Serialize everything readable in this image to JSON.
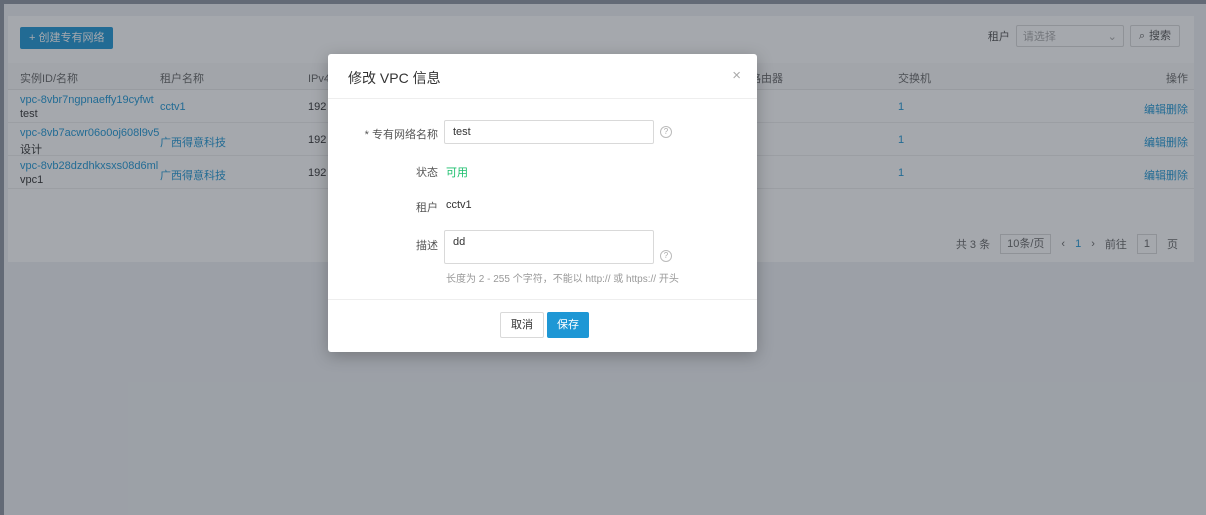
{
  "toolbar": {
    "create_label": "+ 创建专有网络"
  },
  "filter": {
    "tenant_label": "租户",
    "tenant_placeholder": "请选择",
    "search_label": "搜索"
  },
  "table": {
    "headers": [
      "实例ID/名称",
      "租户名称",
      "IPv4网段",
      "路由器",
      "交换机",
      "操作"
    ],
    "rows": [
      {
        "id": "vpc-8vbr7ngpnaeffy19cyfwt",
        "name": "test",
        "tenant": "cctv1",
        "ip": "192",
        "switches": "1",
        "edit": "编辑",
        "delete": "删除"
      },
      {
        "id": "vpc-8vb7acwr06o0oj608l9v5",
        "name": "设计",
        "tenant": "广西得意科技",
        "ip": "192",
        "switches": "1",
        "edit": "编辑",
        "delete": "删除"
      },
      {
        "id": "vpc-8vb28dzdhkxsxs08d6ml",
        "name": "vpc1",
        "tenant": "广西得意科技",
        "ip": "192",
        "switches": "1",
        "edit": "编辑",
        "delete": "删除"
      }
    ]
  },
  "pager": {
    "total": "共 3 条",
    "page_size": "10条/页",
    "prev": "‹",
    "current": "1",
    "next": "›",
    "goto_label": "前往",
    "goto_value": "1",
    "page_unit": "页"
  },
  "modal": {
    "title": "修改 VPC 信息",
    "close": "×",
    "name_label": "* 专有网络名称",
    "name_value": "test",
    "status_label": "状态",
    "status_value": "可用",
    "tenant_label": "租户",
    "tenant_value": "cctv1",
    "desc_label": "描述",
    "desc_value": "dd",
    "hint": "长度为 2 - 255 个字符，不能以 http:// 或 https:// 开头",
    "cancel": "取消",
    "save": "保存"
  },
  "colors": {
    "accent": "#1e97d5",
    "status_ok": "#19be6b"
  }
}
